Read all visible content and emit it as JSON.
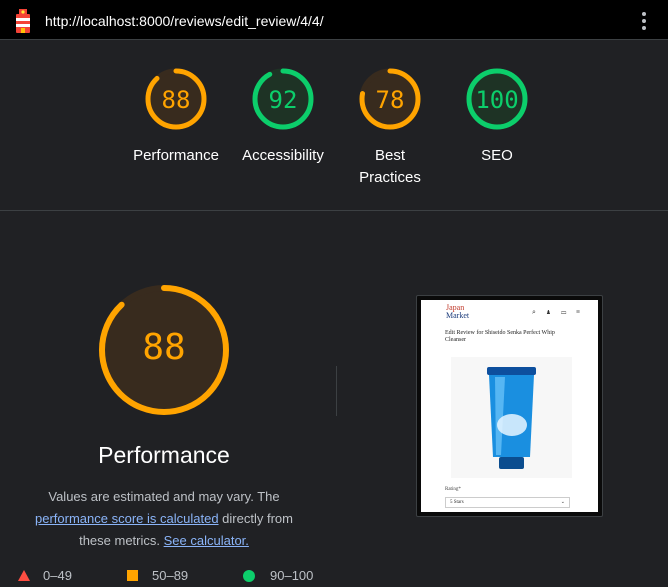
{
  "topbar": {
    "url": "http://localhost:8000/reviews/edit_review/4/4/"
  },
  "categories": [
    {
      "score": "88",
      "label": "Performance",
      "value": 88,
      "color": "#ffa400",
      "bg": "#382b1e"
    },
    {
      "score": "92",
      "label": "Accessibility",
      "value": 92,
      "color": "#0cce6b",
      "bg": "#1e3325"
    },
    {
      "score": "78",
      "label": "Best Practices",
      "value": 78,
      "color": "#ffa400",
      "bg": "#382b1e"
    },
    {
      "score": "100",
      "label": "SEO",
      "value": 100,
      "color": "#0cce6b",
      "bg": "#1e3325"
    }
  ],
  "performance": {
    "score": "88",
    "value": 88,
    "title": "Performance",
    "note_prefix": "Values are estimated and may vary. The",
    "link_score": "performance score is calculated",
    "note_middle": "directly from these metrics.",
    "link_calculator": "See calculator."
  },
  "screenshot": {
    "brand_line1": "Japan",
    "brand_line2": "Market",
    "nav_icons": "⌕ ♟ ▭ ≡",
    "heading": "Edit Review for Shiseido Senka Perfect Whip Cleanser",
    "rating_label": "Rating*",
    "rating_value": "5 Stars",
    "rating_arrow": "⌄"
  },
  "legend": [
    {
      "range": "0–49",
      "color": "#ff4e42"
    },
    {
      "range": "50–89",
      "color": "#ffa400"
    },
    {
      "range": "90–100",
      "color": "#0cce6b"
    }
  ]
}
